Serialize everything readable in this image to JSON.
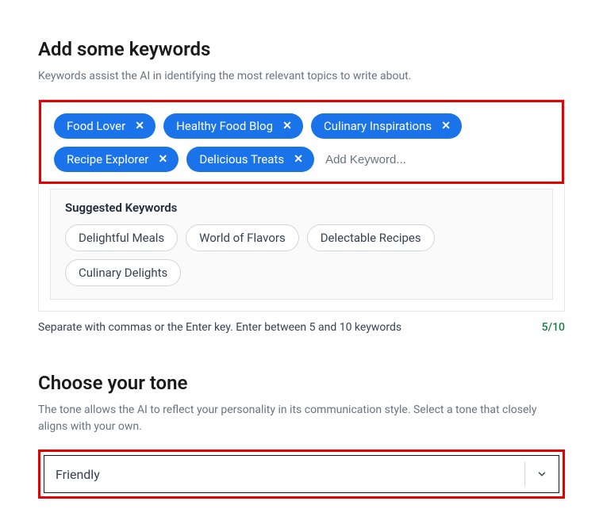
{
  "keywords": {
    "title": "Add some keywords",
    "description": "Keywords assist the AI in identifying the most relevant topics to write about.",
    "selected": [
      {
        "label": "Food Lover"
      },
      {
        "label": "Healthy Food Blog"
      },
      {
        "label": "Culinary Inspirations"
      },
      {
        "label": "Recipe Explorer"
      },
      {
        "label": "Delicious Treats"
      }
    ],
    "add_placeholder": "Add Keyword...",
    "suggested_title": "Suggested Keywords",
    "suggested": [
      {
        "label": "Delightful Meals"
      },
      {
        "label": "World of Flavors"
      },
      {
        "label": "Delectable Recipes"
      },
      {
        "label": "Culinary Delights"
      }
    ],
    "helper": "Separate with commas or the Enter key. Enter between 5 and 10 keywords",
    "counter": "5/10"
  },
  "tone": {
    "title": "Choose your tone",
    "description": "The tone allows the AI to reflect your personality in its communication style. Select a tone that closely aligns with your own.",
    "selected": "Friendly"
  }
}
